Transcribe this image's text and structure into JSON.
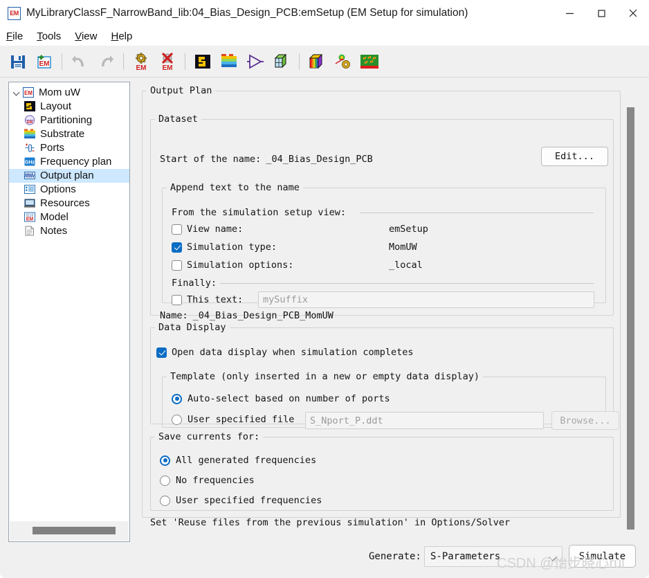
{
  "window": {
    "title": "MyLibraryClassF_NarrowBand_lib:04_Bias_Design_PCB:emSetup (EM Setup for simulation)",
    "app_icon": "em-icon",
    "minimize_label": "—",
    "maximize_label": "□",
    "close_label": "✕"
  },
  "menubar": {
    "items": [
      {
        "mnemonic": "F",
        "rest": "ile",
        "name": "menu-file"
      },
      {
        "mnemonic": "T",
        "rest": "ools",
        "name": "menu-tools"
      },
      {
        "mnemonic": "V",
        "rest": "iew",
        "name": "menu-view"
      },
      {
        "mnemonic": "H",
        "rest": "elp",
        "name": "menu-help"
      }
    ]
  },
  "toolbar": {
    "buttons": [
      {
        "name": "save-icon",
        "title": "Save"
      },
      {
        "name": "save-em-setup-icon",
        "title": "Save EM Setup"
      },
      {
        "name": "undo-icon",
        "title": "Undo"
      },
      {
        "name": "redo-icon",
        "title": "Redo"
      },
      {
        "name": "em-simulate-icon",
        "title": "Simulate EM"
      },
      {
        "name": "em-stop-icon",
        "title": "Stop EM"
      },
      {
        "name": "layout-icon",
        "title": "Layout"
      },
      {
        "name": "substrate-icon",
        "title": "Substrate"
      },
      {
        "name": "emmodel-symbol-icon",
        "title": "EM Model Symbol"
      },
      {
        "name": "mesh-cube-icon",
        "title": "3D Mesh View"
      },
      {
        "name": "rainbow-cube-icon",
        "title": "3D EM Preview"
      },
      {
        "name": "visualization-gear-icon",
        "title": "Visualization Settings"
      },
      {
        "name": "current-density-icon",
        "title": "Current Density"
      }
    ]
  },
  "sidebar": {
    "root": {
      "label": "Mom uW",
      "icon": "em-icon"
    },
    "items": [
      {
        "label": "Layout",
        "icon": "layout-icon",
        "selected": false
      },
      {
        "label": "Partitioning",
        "icon": "partitioning-icon",
        "selected": false
      },
      {
        "label": "Substrate",
        "icon": "substrate-icon",
        "selected": false
      },
      {
        "label": "Ports",
        "icon": "ports-icon",
        "selected": false
      },
      {
        "label": "Frequency plan",
        "icon": "ghz-icon",
        "selected": false
      },
      {
        "label": "Output plan",
        "icon": "output-plan-icon",
        "selected": true
      },
      {
        "label": "Options",
        "icon": "options-icon",
        "selected": false
      },
      {
        "label": "Resources",
        "icon": "resources-icon",
        "selected": false
      },
      {
        "label": "Model",
        "icon": "model-icon",
        "selected": false
      },
      {
        "label": "Notes",
        "icon": "notes-icon",
        "selected": false
      }
    ]
  },
  "main": {
    "group_title": "Output Plan",
    "dataset": {
      "group_title": "Dataset",
      "start_of_name_label": "Start of the name:",
      "start_of_name_value": "_04_Bias_Design_PCB",
      "edit_button": "Edit...",
      "append": {
        "group_title": "Append text to the name",
        "from_view_label": "From the simulation setup view:",
        "rows": [
          {
            "label": "View name:",
            "value": "emSetup",
            "checked": false
          },
          {
            "label": "Simulation type:",
            "value": "MomUW",
            "checked": true
          },
          {
            "label": "Simulation options:",
            "value": "_local",
            "checked": false
          }
        ],
        "finally_label": "Finally:",
        "this_text_label": "This text:",
        "this_text_checked": false,
        "this_text_placeholder": "mySuffix"
      },
      "name_label": "Name:",
      "name_value": "_04_Bias_Design_PCB_MomUW"
    },
    "data_display": {
      "group_title": "Data Display",
      "open_on_complete_label": "Open data display when simulation completes",
      "open_on_complete_checked": true,
      "template": {
        "group_title": "Template (only inserted in a new or empty data display)",
        "auto_select_label": "Auto-select based on number of ports",
        "auto_select_checked": true,
        "user_file_label": "User specified file",
        "user_file_checked": false,
        "user_file_placeholder": "S_Nport_P.ddt",
        "browse_button": "Browse..."
      }
    },
    "save_currents": {
      "group_title": "Save currents for:",
      "options": [
        {
          "label": "All generated frequencies",
          "checked": true
        },
        {
          "label": "No frequencies",
          "checked": false
        },
        {
          "label": "User specified frequencies",
          "checked": false
        }
      ]
    },
    "hint_text": "Set 'Reuse files from the previous simulation' in Options/Solver"
  },
  "bottom": {
    "generate_label": "Generate:",
    "generate_value": "S-Parameters",
    "simulate_button": "Simulate"
  },
  "watermark": "CSDN @怡步晓心rui",
  "colors": {
    "accent": "#0b6cc4",
    "selection": "#cde8ff",
    "window_bg": "#f0f0f0"
  }
}
